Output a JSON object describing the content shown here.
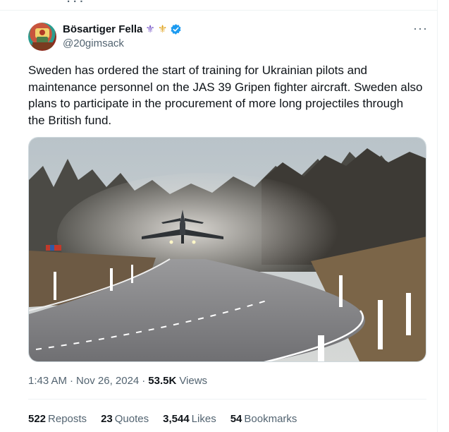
{
  "previous_tweet": {
    "stub_text": "· · ·"
  },
  "author": {
    "display_name": "Bösartiger Fella",
    "handle": "@20gimsack",
    "badges": [
      "fleur-de-lis-purple",
      "fleur-de-lis-gold",
      "verified-badge"
    ],
    "verified_color": "#1d9bf0"
  },
  "more_options": "···",
  "tweet": {
    "text": "Sweden has ordered the start of training for Ukrainian pilots and maintenance personnel on the JAS 39 Gripen fighter aircraft. Sweden also plans to participate in the procurement of more long projectiles through the British fund."
  },
  "media": {
    "type": "photo",
    "subject": "fighter-jet-taking-off-from-road"
  },
  "meta": {
    "time": "1:43 AM",
    "separator": "·",
    "date": "Nov 26, 2024",
    "separator2": "·",
    "views_count": "53.5K",
    "views_label": "Views"
  },
  "stats": {
    "reposts_count": "522",
    "reposts_label": "Reposts",
    "quotes_count": "23",
    "quotes_label": "Quotes",
    "likes_count": "3,544",
    "likes_label": "Likes",
    "bookmarks_count": "54",
    "bookmarks_label": "Bookmarks"
  },
  "colors": {
    "text_primary": "#0f1419",
    "text_secondary": "#536471",
    "border": "#eff3f4"
  }
}
